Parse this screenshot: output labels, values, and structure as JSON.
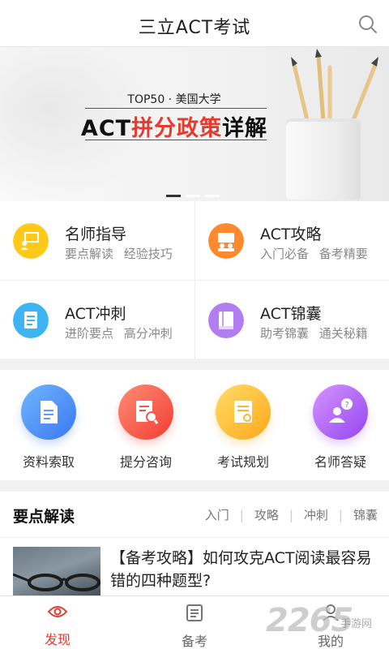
{
  "header": {
    "title": "三立ACT考试"
  },
  "banner": {
    "subtitle": "TOP50 · 美国大学",
    "headline_prefix": "ACT",
    "headline_red": "拼分政策",
    "headline_suffix": "详解"
  },
  "features": [
    {
      "title": "名师指导",
      "subtitle": "要点解读 经验技巧",
      "icon": "teacher-icon",
      "color": "#ffc91a"
    },
    {
      "title": "ACT攻略",
      "subtitle": "入门必备 备考精要",
      "icon": "strategy-icon",
      "color": "#ff8a2e"
    },
    {
      "title": "ACT冲刺",
      "subtitle": "进阶要点 高分冲刺",
      "icon": "sprint-icon",
      "color": "#3db5f3"
    },
    {
      "title": "ACT锦囊",
      "subtitle": "助考锦囊 通关秘籍",
      "icon": "tips-icon",
      "color": "#b17df0"
    }
  ],
  "services": [
    {
      "label": "资料索取",
      "icon": "document-icon",
      "color_a": "#5aa8ff",
      "color_b": "#3c7cf2"
    },
    {
      "label": "提分咨询",
      "icon": "consult-icon",
      "color_a": "#ff7a6a",
      "color_b": "#f24438"
    },
    {
      "label": "考试规划",
      "icon": "plan-icon",
      "color_a": "#ffd35a",
      "color_b": "#ffae1c"
    },
    {
      "label": "名师答疑",
      "icon": "qa-icon",
      "color_a": "#c785ff",
      "color_b": "#9a4ff2"
    }
  ],
  "section": {
    "title": "要点解读",
    "tabs": [
      "入门",
      "攻略",
      "冲刺",
      "锦囊"
    ]
  },
  "article": {
    "title": "【备考攻略】如何攻克ACT阅读最容易错的四种题型?"
  },
  "tabbar": [
    {
      "label": "发现",
      "icon": "eye-icon",
      "active": true
    },
    {
      "label": "备考",
      "icon": "list-icon",
      "active": false
    },
    {
      "label": "我的",
      "icon": "user-icon",
      "active": false
    }
  ],
  "watermark": {
    "logo": "2265",
    "text": "手游网"
  },
  "colors": {
    "accent": "#e63a2d"
  }
}
